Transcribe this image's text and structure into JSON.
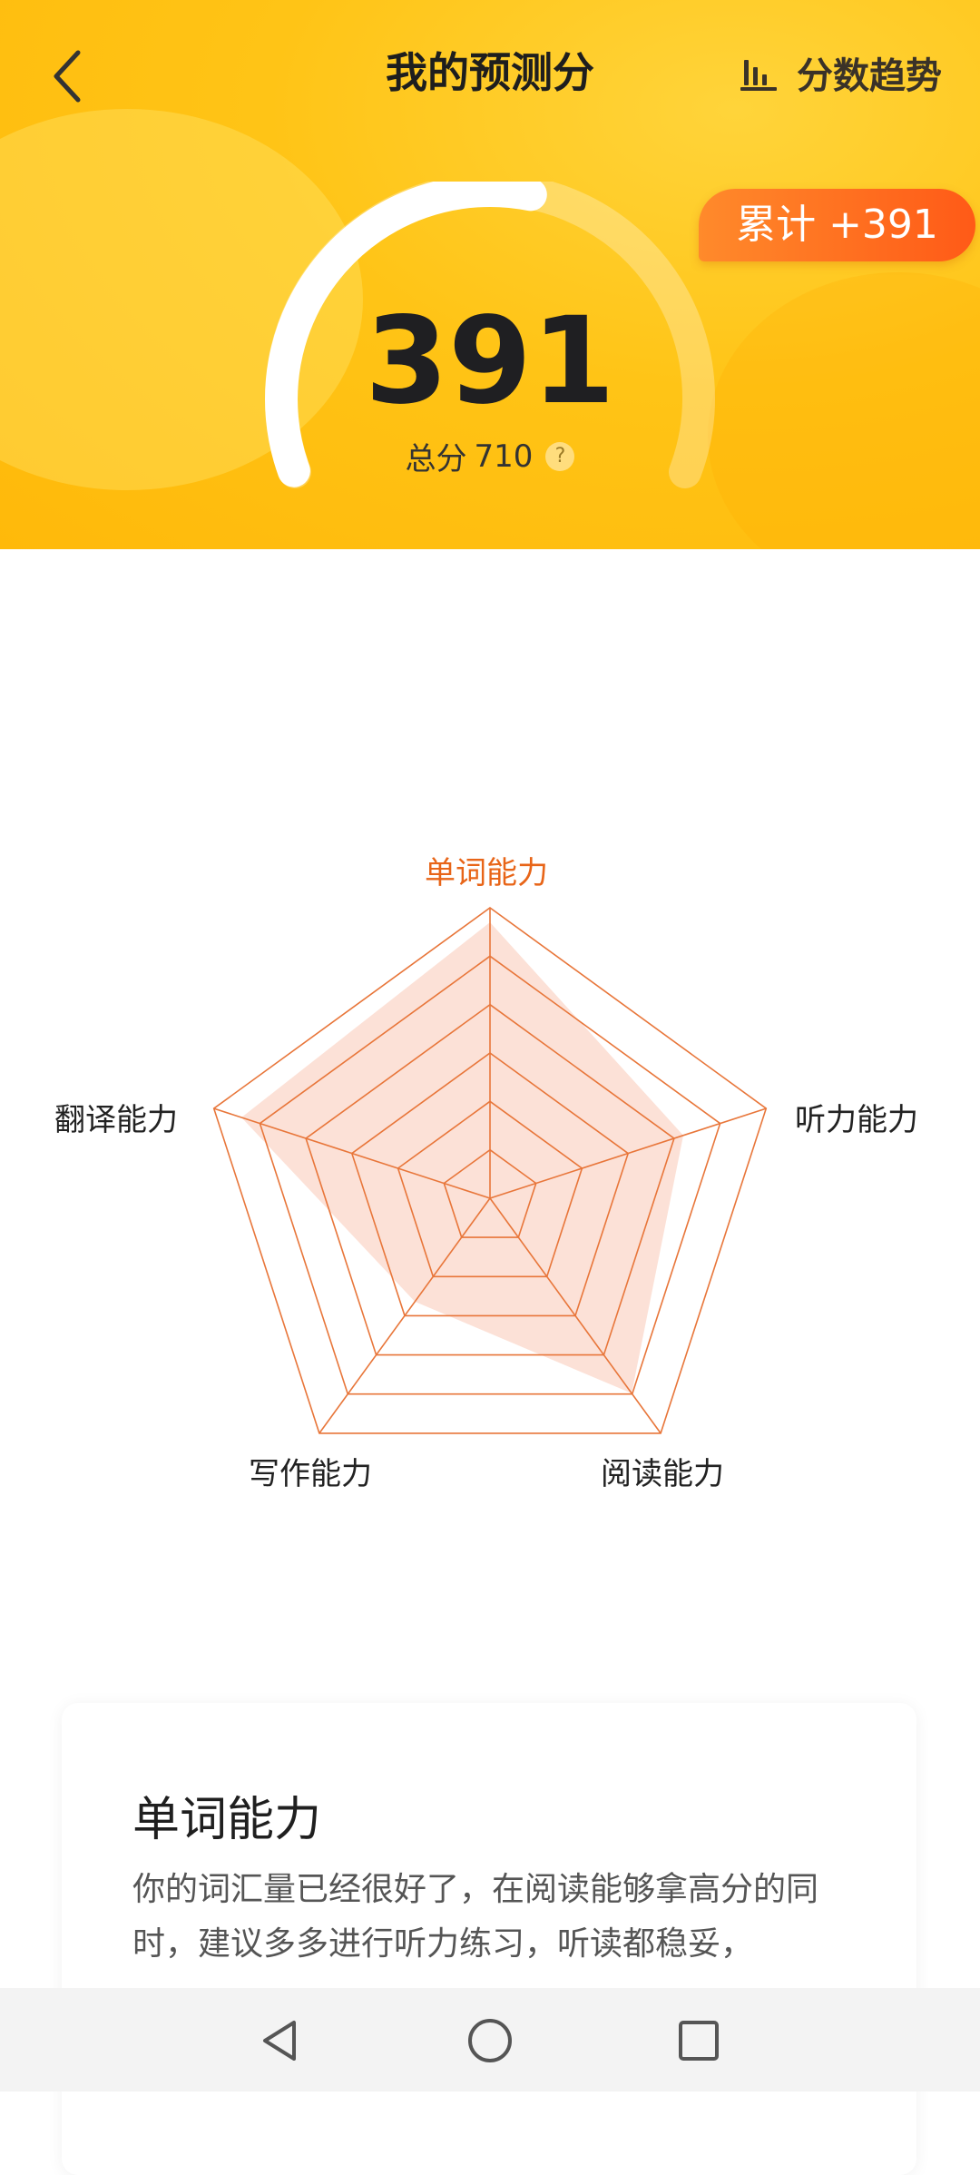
{
  "header": {
    "title": "我的预测分",
    "back_icon": "chevron-left-icon",
    "trend_icon": "bar-chart-icon",
    "trend_label": "分数趋势",
    "cumulative_badge": "累计 +391",
    "colors": {
      "background": "#ffc416",
      "badge": "#ff6a1e"
    }
  },
  "score": {
    "value": "391",
    "total_label": "总分",
    "total_value": "710",
    "help_icon": "question-icon",
    "progress_fraction": 0.551
  },
  "radar": {
    "axes": [
      {
        "label": "单词能力",
        "active": true
      },
      {
        "label": "听力能力",
        "active": false
      },
      {
        "label": "阅读能力",
        "active": false
      },
      {
        "label": "写作能力",
        "active": false
      },
      {
        "label": "翻译能力",
        "active": false
      }
    ],
    "values": [
      0.95,
      0.7,
      0.83,
      0.44,
      0.9
    ],
    "ring_levels": 6,
    "colors": {
      "grid": "#e8763a",
      "fill": "#fcdcd0",
      "active_label": "#e86518"
    }
  },
  "detail": {
    "title": "单词能力",
    "text": "你的词汇量已经很好了，在阅读能够拿高分的同时，建议多多进行听力练习，听读都稳妥，"
  },
  "system_nav": {
    "back_icon": "triangle-back-icon",
    "home_icon": "circle-home-icon",
    "recents_icon": "square-recents-icon"
  }
}
